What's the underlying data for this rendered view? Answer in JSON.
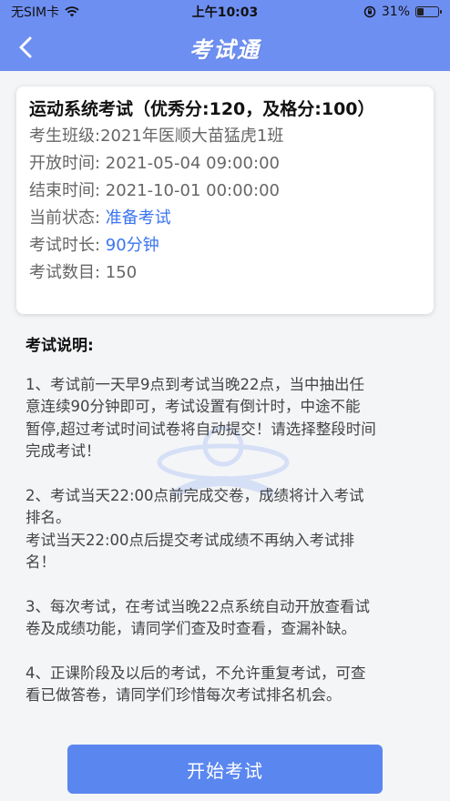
{
  "status_bar": {
    "carrier": "无SIM卡",
    "time": "上午10:03",
    "battery": "31%",
    "battery_level": 0.31
  },
  "nav": {
    "title": "考试通"
  },
  "exam": {
    "title": "运动系统考试（优秀分:120，及格分:100）",
    "class_label": "考生班级:",
    "class_value": "2021年医顺大苗猛虎1班",
    "open_label": "开放时间: ",
    "open_value": "2021-05-04 09:00:00",
    "end_label": "结束时间: ",
    "end_value": "2021-10-01 00:00:00",
    "status_label": "当前状态: ",
    "status_value": "准备考试",
    "duration_label": "考试时长: ",
    "duration_value": "90分钟",
    "count_label": "考试数目: ",
    "count_value": "150"
  },
  "description": {
    "title": "考试说明:",
    "p1": [
      "1、考试前一天早9点到考试当晚22点，当中抽出任",
      "意连续90分钟即可，考试设置有倒计时，中途不能",
      "暂停,超过考试时间试卷将自动提交！请选择整段时间",
      "完成考试！"
    ],
    "p2": [
      "2、考试当天22:00点前完成交卷，成绩将计入考试",
      "排名。",
      "考试当天22:00点后提交考试成绩不再纳入考试排",
      "名！"
    ],
    "p3": [
      "3、每次考试，在考试当晚22点系统自动开放查看试",
      "卷及成绩功能，请同学们查及时查看，查漏补缺。"
    ],
    "p4": [
      "4、正课阶段及以后的考试，不允许重复考试，可查",
      "看已做答卷，请同学们珍惜每次考试排名机会。"
    ]
  },
  "actions": {
    "start_label": "开始考试"
  }
}
